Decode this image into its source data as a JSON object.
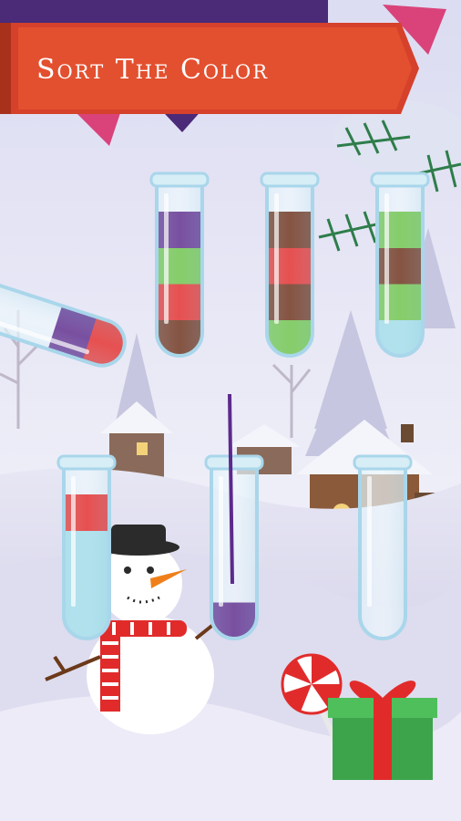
{
  "title": "Sort The Color",
  "colors": {
    "purple": "#5c2a8c",
    "green": "#6cc24a",
    "red": "#e12b2b",
    "brown": "#6b2f1a",
    "lightblue": "#9fdbe8",
    "banner": "#e3502f",
    "banner_dark": "#a8311c"
  },
  "tubes": [
    {
      "name": "tube-1",
      "layers": [
        "brown",
        "red",
        "green",
        "purple"
      ]
    },
    {
      "name": "tube-2",
      "layers": [
        "green",
        "brown",
        "red",
        "brown"
      ]
    },
    {
      "name": "tube-3",
      "layers": [
        "lightblue",
        "green",
        "brown",
        "green"
      ]
    },
    {
      "name": "tube-4-pouring",
      "layers": [
        "red",
        "purple"
      ]
    },
    {
      "name": "tube-5",
      "layers": [
        "lightblue",
        "lightblue",
        "lightblue",
        "red"
      ]
    },
    {
      "name": "tube-6",
      "layers": [
        "purple"
      ]
    },
    {
      "name": "tube-7",
      "layers": []
    }
  ]
}
